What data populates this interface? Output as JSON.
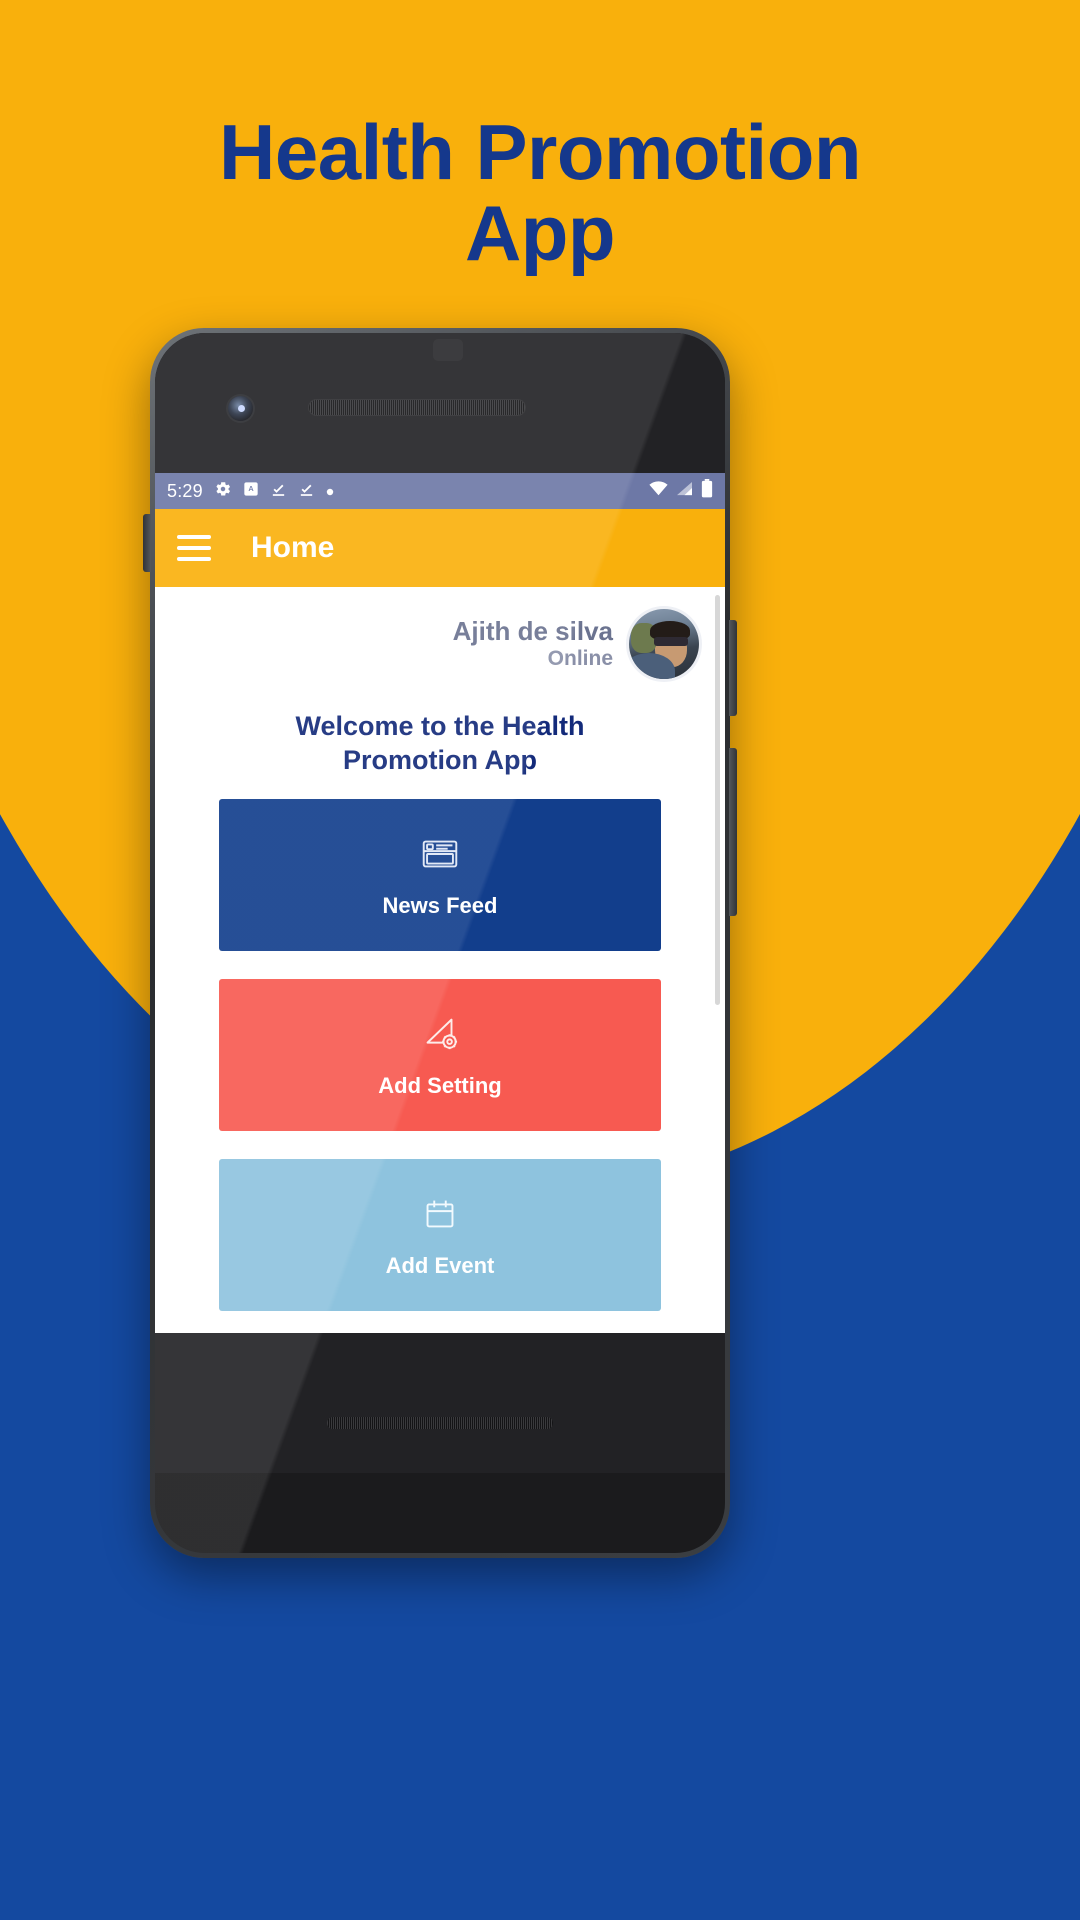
{
  "promo": {
    "title_line1": "Health Promotion",
    "title_line2": "App",
    "bg_yellow": "#F9B00C",
    "bg_blue": "#1449A0",
    "title_color": "#15388C"
  },
  "status_bar": {
    "time": "5:29",
    "icons_left": [
      "gear-icon",
      "screenshot-icon",
      "download-done-icon",
      "download-done-icon",
      "dot-icon"
    ],
    "icons_right": [
      "wifi-icon",
      "cellular-signal-icon",
      "battery-icon"
    ],
    "background": "#6D78A6"
  },
  "app_bar": {
    "menu_icon": "hamburger-menu-icon",
    "title": "Home",
    "background": "#F9B00C",
    "text_color": "#FFFFFF"
  },
  "profile": {
    "name": "Ajith de silva",
    "status": "Online",
    "avatar_icon": "user-avatar-photo"
  },
  "welcome": {
    "line1": "Welcome to the Health",
    "line2": "Promotion App",
    "color": "#132A7A"
  },
  "cards": [
    {
      "label": "News Feed",
      "icon": "news-feed-window-icon",
      "color": "#123E8C"
    },
    {
      "label": "Add Setting",
      "icon": "ruler-gear-settings-icon",
      "color": "#F75A51"
    },
    {
      "label": "Add Event",
      "icon": "calendar-icon",
      "color": "#8EC3DE"
    }
  ],
  "nav_bar": {
    "back": "back-triangle-icon",
    "home": "home-circle-icon",
    "recents": "recents-square-icon"
  }
}
